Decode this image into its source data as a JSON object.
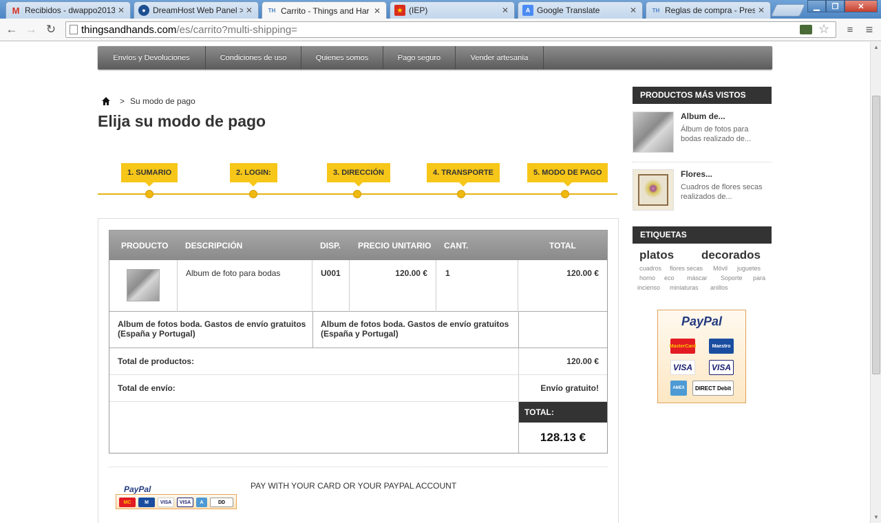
{
  "browser": {
    "tabs": [
      {
        "title": "Recibidos - dwappo2013",
        "icon": "gmail-icon"
      },
      {
        "title": "DreamHost Web Panel >",
        "icon": "dreamhost-icon"
      },
      {
        "title": "Carrito - Things and Har",
        "icon": "th-icon"
      },
      {
        "title": "(IEP)",
        "icon": "iep-icon"
      },
      {
        "title": "Google Translate",
        "icon": "translate-icon"
      },
      {
        "title": "Reglas de compra - Prest",
        "icon": "th-icon"
      }
    ],
    "url_host": "thingsandhands.com",
    "url_path": "/es/carrito?multi-shipping="
  },
  "topnav": [
    "Envíos y Devoluciones",
    "Condiciones de uso",
    "Quienes somos",
    "Pago seguro",
    "Vender artesanía"
  ],
  "breadcrumb": {
    "separator": ">",
    "current": "Su modo de pago"
  },
  "page_title": "Elija su modo de pago",
  "steps": [
    "1. SUMARIO",
    "2. LOGIN:",
    "3. DIRECCIÓN",
    "4. TRANSPORTE",
    "5. MODO DE PAGO"
  ],
  "cart": {
    "headers": {
      "product": "PRODUCTO",
      "description": "DESCRIPCIÓN",
      "availability": "DISP.",
      "unit_price": "PRECIO UNITARIO",
      "quantity": "CANT.",
      "total": "TOTAL"
    },
    "item": {
      "name": "Album de foto para bodas",
      "ref": "U001",
      "unit_price": "120.00 €",
      "quantity": "1",
      "total": "120.00 €"
    },
    "desc_left": "Album de fotos boda. Gastos de envío gratuitos (España y Portugal)",
    "desc_right": "Album de fotos boda. Gastos de envío gratuitos (España y Portugal)",
    "total_products_label": "Total de productos:",
    "total_products_value": "120.00 €",
    "shipping_label": "Total de envío:",
    "shipping_value": "Envío gratuito!",
    "total_label": "TOTAL:",
    "total_value": "128.13 €"
  },
  "payment": {
    "paypal_text": "PAY WITH YOUR CARD OR YOUR PAYPAL ACCOUNT",
    "paypal_logo": "PayPal"
  },
  "sidebar": {
    "most_viewed_title": "PRODUCTOS MÁS VISTOS",
    "most_viewed": [
      {
        "title": "Album de...",
        "desc": "Álbum de fotos para bodas realizado de..."
      },
      {
        "title": "Flores...",
        "desc": "Cuadros de flores secas realizados de..."
      }
    ],
    "tags_title": "ETIQUETAS",
    "tags_big": [
      "platos",
      "decorados"
    ],
    "tags_small": [
      "cuadros",
      "flores secas",
      "Móvil",
      "juguetes",
      "horno",
      "eco",
      "máscar",
      "Soporte",
      "para",
      "incienso",
      "miniaturas",
      "anillos"
    ],
    "paypal_logo": "PayPal",
    "cards": [
      "MasterCard",
      "Maestro",
      "VISA",
      "VISA",
      "AMEX",
      "DIRECT Debit"
    ]
  },
  "colors": {
    "accent": "#f6c619",
    "nav_dark": "#5c5c5c",
    "header_dark": "#333333"
  }
}
